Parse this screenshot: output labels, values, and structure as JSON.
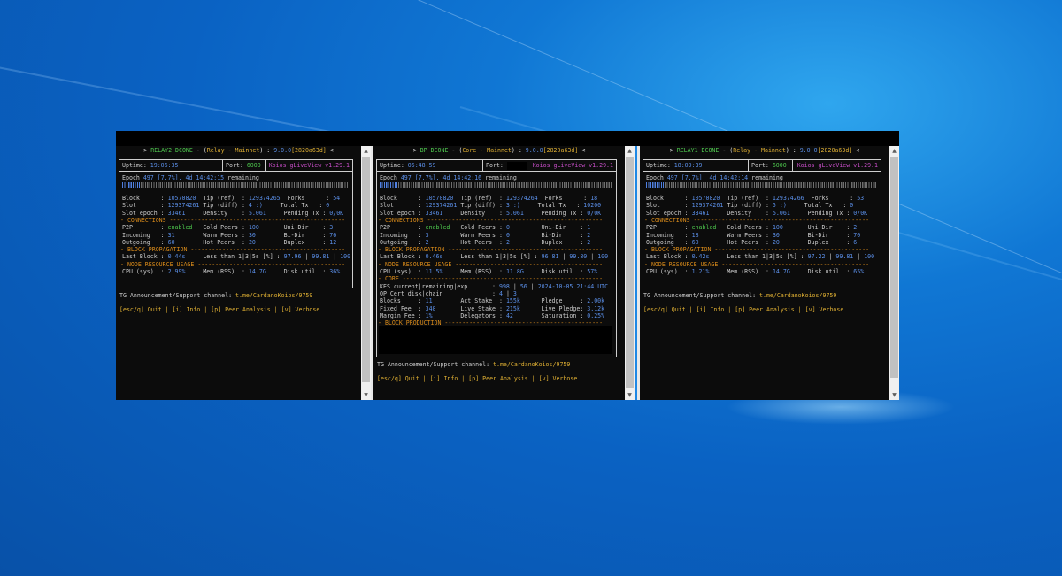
{
  "terminals": [
    {
      "id": "relay2",
      "title": {
        "prefix": "> ",
        "name": "RELAY2 DCONE",
        "dash1": " - (",
        "role": "Relay - Mainnet",
        "dash2": ") : ",
        "version": "9.0.0",
        "hash": "[2820a63d]",
        "suffix": " <"
      },
      "header": {
        "uptime_label": "Uptime: ",
        "uptime": "19:06:35",
        "port_label": "Port: ",
        "port": "6000",
        "tool": "Koios gLiveView v1.29.1"
      },
      "epoch": {
        "label": "Epoch ",
        "num": "497",
        "pct": " [7.7%]",
        "remain": ", 4d 14:42:15",
        "remain_word": " remaining",
        "progress": 0.077
      },
      "stats": [
        [
          "Block      : ",
          "10570820",
          "  Tip (ref)  : ",
          "129374265",
          "  Forks      : ",
          "54"
        ],
        [
          "Slot       : ",
          "129374261",
          " Tip (diff) : ",
          "4 :)",
          "     Total Tx   : ",
          "0"
        ],
        [
          "Slot epoch : ",
          "33461",
          "     Density    : ",
          "5.061",
          "     Pending Tx : ",
          "0/0K"
        ]
      ],
      "sections": {
        "connections": "- CONNECTIONS --------------------------------------------------",
        "propagation": "- BLOCK PROPAGATION --------------------------------------------",
        "resource": "- NODE RESOURCE USAGE ------------------------------------------"
      },
      "conn": [
        [
          "P2P        : ",
          "enabled",
          "   Cold Peers : ",
          "100",
          "       Uni-Dir    : ",
          "3"
        ],
        [
          "Incoming   : ",
          "31",
          "        Warm Peers : ",
          "30",
          "        Bi-Dir     : ",
          "76"
        ],
        [
          "Outgoing   : ",
          "60",
          "        Hot Peers  : ",
          "20",
          "        Duplex     : ",
          "12"
        ]
      ],
      "prop": {
        "label": "Last Block : ",
        "value": "0.44s",
        "mid": "     Less than 1|3|5s [%] : ",
        "v1": "97.96",
        "sep1": " | ",
        "v2": "99.81",
        "sep2": " | ",
        "v3": "100"
      },
      "res": {
        "cpu_label": "CPU (sys)  : ",
        "cpu": "2.99%",
        "mem_label": "     Mem (RSS)  : ",
        "mem": "14.7G",
        "disk_label": "     Disk util  : ",
        "disk": "36%"
      },
      "tg": {
        "label": "TG Announcement/Support channel: ",
        "link": "t.me/CardanoKoios/9759"
      },
      "keys": {
        "quit": "[esc/q] Quit",
        "info": "[i] Info",
        "peer": "[p] Peer Analysis",
        "verbose": "[v] Verbose",
        "sep": " | "
      }
    },
    {
      "id": "bp",
      "title": {
        "prefix": "> ",
        "name": "BP DCONE",
        "dash1": " - (",
        "role": "Core - Mainnet",
        "dash2": ") : ",
        "version": "9.0.0",
        "hash": "[2820a63d]",
        "suffix": " <"
      },
      "header": {
        "uptime_label": "Uptime: ",
        "uptime": "05:48:59",
        "port_label": "Port: ",
        "port": "",
        "tool": "Koios gLiveView v1.29.1"
      },
      "epoch": {
        "label": "Epoch ",
        "num": "497",
        "pct": " [7.7%]",
        "remain": ", 4d 14:42:16",
        "remain_word": " remaining",
        "progress": 0.077
      },
      "stats": [
        [
          "Block      : ",
          "10570820",
          "  Tip (ref)  : ",
          "129374264",
          "  Forks      : ",
          "18"
        ],
        [
          "Slot       : ",
          "129374261",
          " Tip (diff) : ",
          "3 :)",
          "     Total Tx   : ",
          "10200"
        ],
        [
          "Slot epoch : ",
          "33461",
          "     Density    : ",
          "5.061",
          "     Pending Tx : ",
          "0/0K"
        ]
      ],
      "sections": {
        "connections": "- CONNECTIONS --------------------------------------------------",
        "propagation": "- BLOCK PROPAGATION --------------------------------------------",
        "resource": "- NODE RESOURCE USAGE ------------------------------------------",
        "core": "- CORE ---------------------------------------------------------",
        "production": "- BLOCK PRODUCTION ---------------------------------------------"
      },
      "conn": [
        [
          "P2P        : ",
          "enabled",
          "   Cold Peers : ",
          "0",
          "         Uni-Dir    : ",
          "1"
        ],
        [
          "Incoming   : ",
          "3",
          "         Warm Peers : ",
          "0",
          "         Bi-Dir     : ",
          "2"
        ],
        [
          "Outgoing   : ",
          "2",
          "         Hot Peers  : ",
          "2",
          "         Duplex     : ",
          "2"
        ]
      ],
      "prop": {
        "label": "Last Block : ",
        "value": "0.46s",
        "mid": "     Less than 1|3|5s [%] : ",
        "v1": "96.81",
        "sep1": " | ",
        "v2": "99.80",
        "sep2": " | ",
        "v3": "100"
      },
      "res": {
        "cpu_label": "CPU (sys)  : ",
        "cpu": "11.5%",
        "mem_label": "     Mem (RSS)  : ",
        "mem": "11.8G",
        "disk_label": "     Disk util  : ",
        "disk": "57%"
      },
      "core": {
        "kes_label": "KES current|remaining|exp       : ",
        "kes_cur": "998",
        "kes_sep1": " | ",
        "kes_rem": "56",
        "kes_sep2": " | ",
        "kes_exp": "2024-10-05 21:44 UTC",
        "opcert_label": "OP Cert disk|chain              : ",
        "op_disk": "4",
        "op_sep": " | ",
        "op_chain": "3",
        "rows": [
          [
            "Blocks     : ",
            "11",
            "        Act Stake  : ",
            "155k",
            "      Pledge     : ",
            "2.00k"
          ],
          [
            "Fixed Fee  : ",
            "340",
            "       Live Stake : ",
            "215k",
            "      Live Pledge: ",
            "3.12k"
          ],
          [
            "Margin Fee : ",
            "1%",
            "        Delegators : ",
            "42",
            "        Saturation : ",
            "0.25%"
          ]
        ]
      },
      "tg": {
        "label": "TG Announcement/Support channel: ",
        "link": "t.me/CardanoKoios/9759"
      },
      "keys": {
        "quit": "[esc/q] Quit",
        "info": "[i] Info",
        "peer": "[p] Peer Analysis",
        "verbose": "[v] Verbose",
        "sep": " | "
      }
    },
    {
      "id": "relay1",
      "title": {
        "prefix": "> ",
        "name": "RELAY1 DCONE",
        "dash1": " - (",
        "role": "Relay - Mainnet",
        "dash2": ") : ",
        "version": "9.0.0",
        "hash": "[2820a63d]",
        "suffix": " <"
      },
      "header": {
        "uptime_label": "Uptime: ",
        "uptime": "18:09:39",
        "port_label": "Port: ",
        "port": "6000",
        "tool": "Koios gLiveView v1.29.1"
      },
      "epoch": {
        "label": "Epoch ",
        "num": "497",
        "pct": " [7.7%]",
        "remain": ", 4d 14:42:14",
        "remain_word": " remaining",
        "progress": 0.077
      },
      "stats": [
        [
          "Block      : ",
          "10570820",
          "  Tip (ref)  : ",
          "129374266",
          "  Forks      : ",
          "53"
        ],
        [
          "Slot       : ",
          "129374261",
          " Tip (diff) : ",
          "5 :)",
          "     Total Tx   : ",
          "0"
        ],
        [
          "Slot epoch : ",
          "33461",
          "     Density    : ",
          "5.061",
          "     Pending Tx : ",
          "0/0K"
        ]
      ],
      "sections": {
        "connections": "- CONNECTIONS --------------------------------------------------",
        "propagation": "- BLOCK PROPAGATION --------------------------------------------",
        "resource": "- NODE RESOURCE USAGE ------------------------------------------"
      },
      "conn": [
        [
          "P2P        : ",
          "enabled",
          "   Cold Peers : ",
          "100",
          "       Uni-Dir    : ",
          "2"
        ],
        [
          "Incoming   : ",
          "18",
          "        Warm Peers : ",
          "30",
          "        Bi-Dir     : ",
          "70"
        ],
        [
          "Outgoing   : ",
          "60",
          "        Hot Peers  : ",
          "20",
          "        Duplex     : ",
          "6"
        ]
      ],
      "prop": {
        "label": "Last Block : ",
        "value": "0.42s",
        "mid": "     Less than 1|3|5s [%] : ",
        "v1": "97.22",
        "sep1": " | ",
        "v2": "99.81",
        "sep2": " | ",
        "v3": "100"
      },
      "res": {
        "cpu_label": "CPU (sys)  : ",
        "cpu": "1.21%",
        "mem_label": "     Mem (RSS)  : ",
        "mem": "14.7G",
        "disk_label": "     Disk util  : ",
        "disk": "65%"
      },
      "tg": {
        "label": "TG Announcement/Support channel: ",
        "link": "t.me/CardanoKoios/9759"
      },
      "keys": {
        "quit": "[esc/q] Quit",
        "info": "[i] Info",
        "peer": "[p] Peer Analysis",
        "verbose": "[v] Verbose",
        "sep": " | "
      }
    }
  ],
  "colors": {
    "label": "#cccccc",
    "value": "#5b8fe8",
    "accent_green": "#4ec94e",
    "section": "#d88a1a",
    "tool": "#c74ec7",
    "title_name": "#4ec94e",
    "title_role": "#e0b033"
  }
}
